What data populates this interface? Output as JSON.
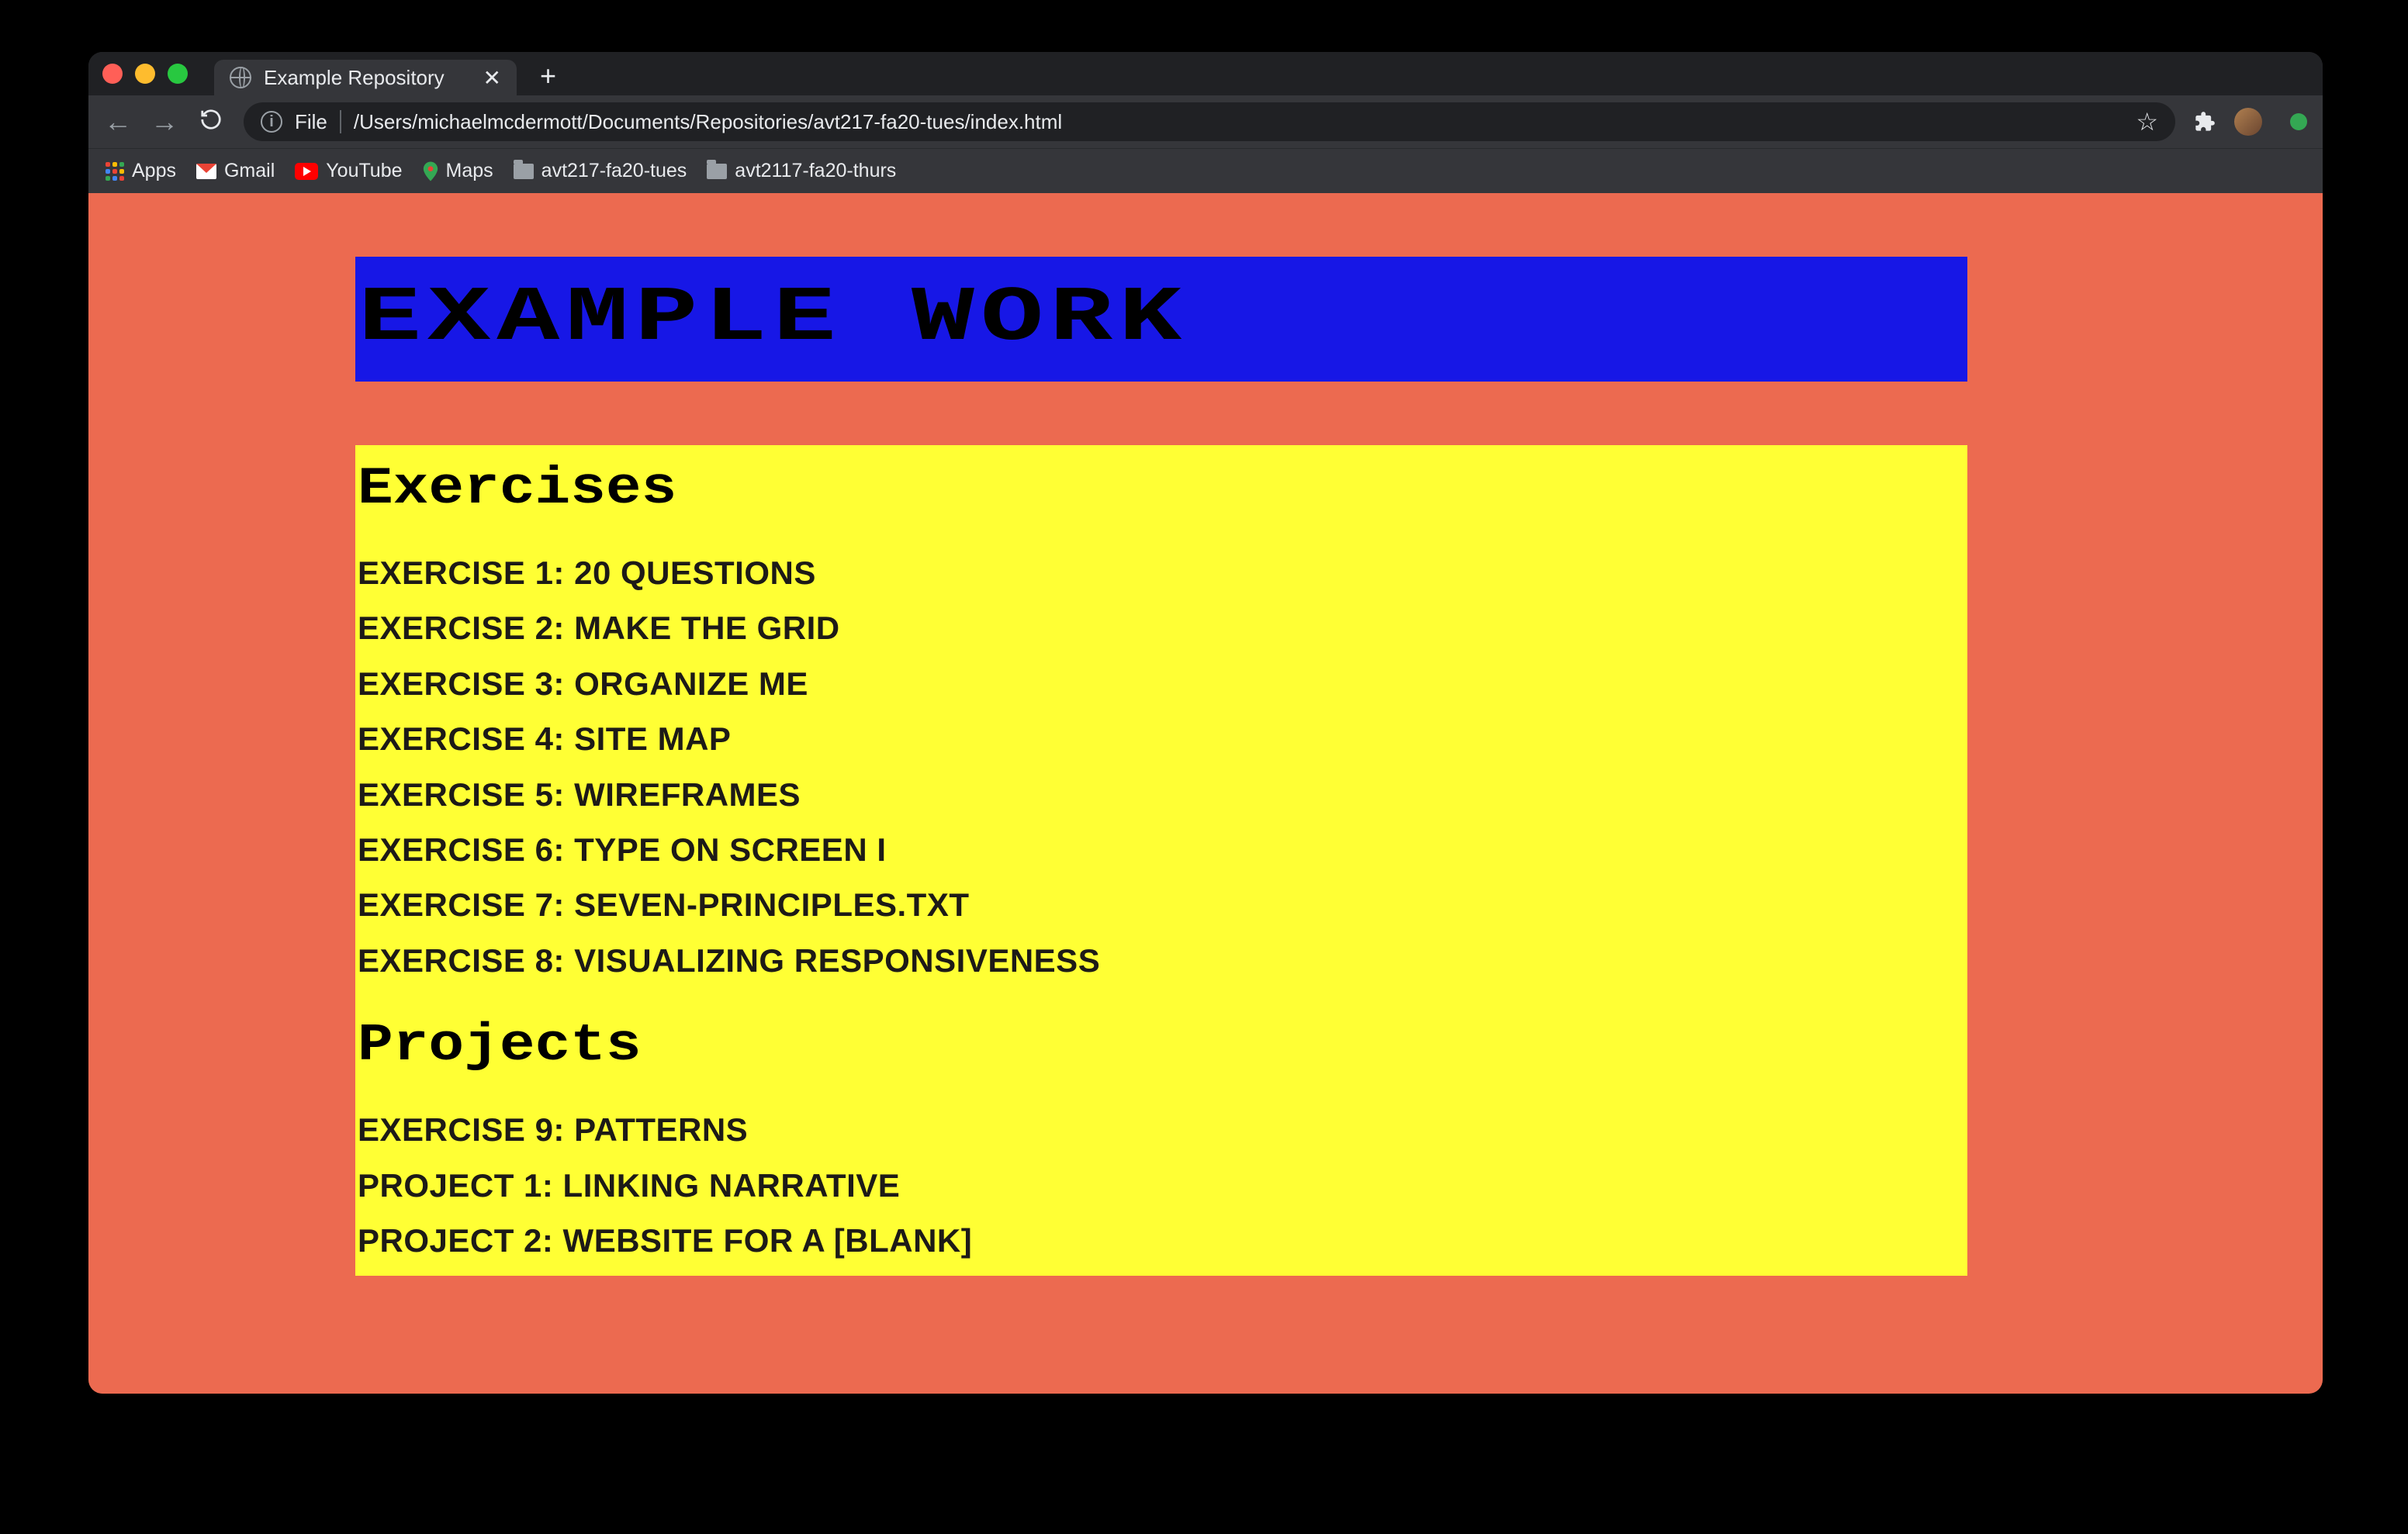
{
  "browser": {
    "tab_title": "Example Repository",
    "url_prefix": "File",
    "url_path": "/Users/michaelmcdermott/Documents/Repositories/avt217-fa20-tues/index.html",
    "bookmarks": {
      "apps": "Apps",
      "gmail": "Gmail",
      "youtube": "YouTube",
      "maps": "Maps",
      "folder1": "avt217-fa20-tues",
      "folder2": "avt2117-fa20-thurs"
    }
  },
  "page": {
    "banner": "EXAMPLE WORK",
    "section1": "Exercises",
    "exercises": [
      "EXERCISE 1: 20 QUESTIONS",
      "EXERCISE 2: MAKE THE GRID",
      "EXERCISE 3: ORGANIZE ME",
      "EXERCISE 4: SITE MAP",
      "EXERCISE 5: WIREFRAMES",
      "EXERCISE 6: TYPE ON SCREEN I",
      "EXERCISE 7: SEVEN-PRINCIPLES.TXT",
      "EXERCISE 8: VISUALIZING RESPONSIVENESS"
    ],
    "section2": "Projects",
    "projects": [
      "EXERCISE 9: PATTERNS",
      "PROJECT 1: LINKING NARRATIVE",
      "PROJECT 2: WEBSITE FOR A [BLANK]"
    ]
  }
}
